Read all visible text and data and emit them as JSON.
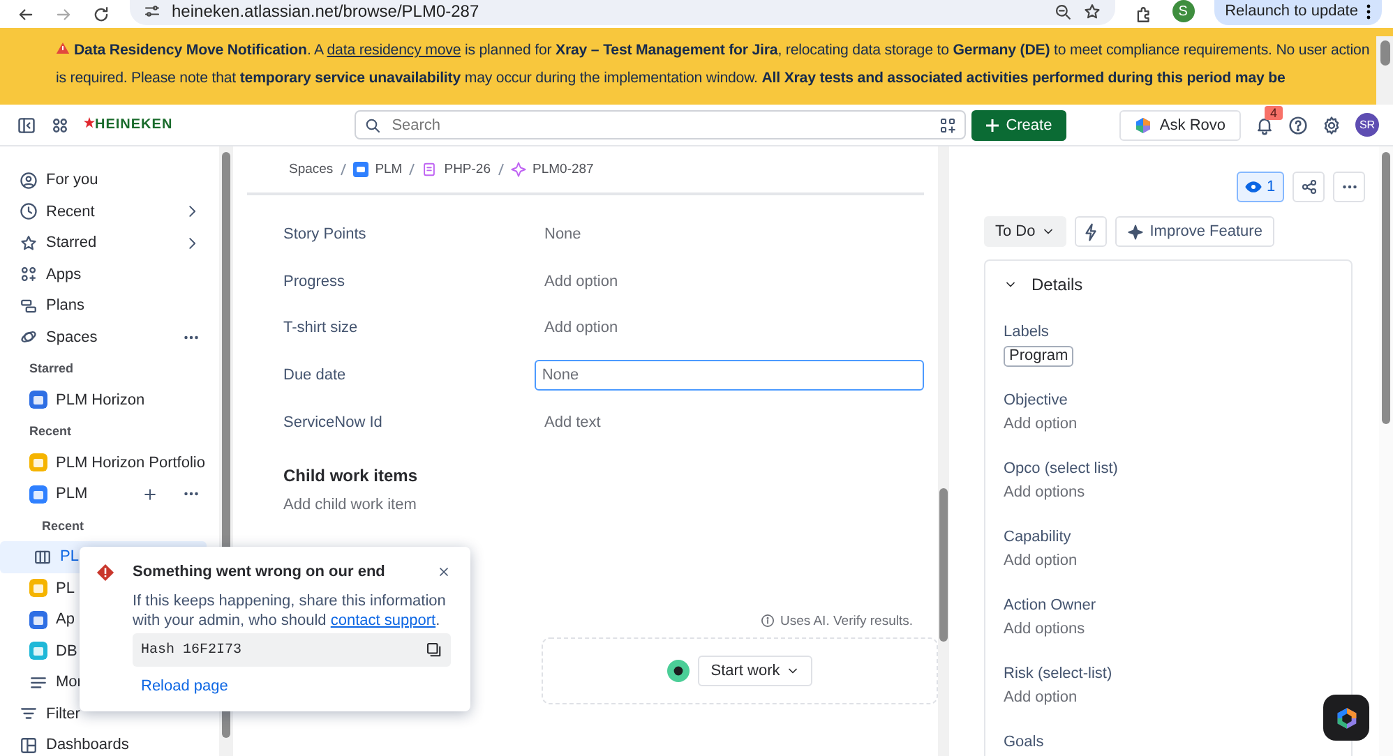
{
  "browser": {
    "url": "heineken.atlassian.net/browse/PLM0-287",
    "avatar": "S",
    "relaunch": "Relaunch to update"
  },
  "banner": {
    "title": "Data Residency Move Notification",
    "before": ". A ",
    "link": "data residency move",
    "after": " is planned for **Xray – Test Management for Jira**, relocating data storage to **Germany (DE)** to meet compliance requirements. No user action is required. Please note that **temporary service unavailability** may occur during the implementation window. **All Xray tests and associated activities performed during this period may be**"
  },
  "header": {
    "logo": "HEINEKEN",
    "search": {
      "placeholder": "Search"
    },
    "create": "Create",
    "ask": "Ask Rovo",
    "notifications": "4",
    "avatar": "SR"
  },
  "sidebar": {
    "items": [
      {
        "kind": "nav",
        "label": "For you",
        "selected": false
      },
      {
        "kind": "nav",
        "label": "Recent",
        "selected": false
      },
      {
        "kind": "nav",
        "label": "Starred",
        "selected": false
      },
      {
        "kind": "nav",
        "label": "Apps",
        "selected": false
      },
      {
        "kind": "nav",
        "label": "Plans",
        "selected": false
      },
      {
        "kind": "nav",
        "label": "Spaces",
        "selected": false
      },
      {
        "kind": "heading",
        "label": "Starred"
      },
      {
        "kind": "space",
        "label": "PLM Horizon",
        "color": "#2f6fe4",
        "selected": false
      },
      {
        "kind": "heading",
        "label": "Recent"
      },
      {
        "kind": "space",
        "label": "PLM Horizon Portfolio",
        "color": "#f5b400",
        "selected": false
      },
      {
        "kind": "space",
        "label": "PLM",
        "color": "#2f80ff",
        "selected": false
      },
      {
        "kind": "subheading",
        "label": "Recent"
      },
      {
        "kind": "board",
        "label": "PL",
        "selected": true
      },
      {
        "kind": "space",
        "label": "PL",
        "color": "#f5b400",
        "selected": false
      },
      {
        "kind": "space",
        "label": "Ap",
        "color": "#2f6fe4",
        "selected": false
      },
      {
        "kind": "space",
        "label": "DB",
        "color": "#1fb8d8",
        "selected": false
      },
      {
        "kind": "more",
        "label": "Mor",
        "selected": false
      },
      {
        "kind": "nav",
        "label": "Filter",
        "selected": false
      },
      {
        "kind": "nav",
        "label": "Dashboards",
        "selected": false
      }
    ]
  },
  "breadcrumb": [
    {
      "label": "Spaces"
    },
    {
      "label": "PLM",
      "kind": "space"
    },
    {
      "label": "PHP-26",
      "kind": "epic"
    },
    {
      "label": "PLM0-287",
      "kind": "feature"
    }
  ],
  "fields": [
    {
      "label": "Story Points",
      "value": "None",
      "kind": "text"
    },
    {
      "label": "Progress",
      "value": "Add option",
      "kind": "text"
    },
    {
      "label": "T-shirt size",
      "value": "Add option",
      "kind": "text"
    },
    {
      "label": "Due date",
      "value": "None",
      "kind": "input"
    },
    {
      "label": "ServiceNow Id",
      "value": "Add text",
      "kind": "text"
    }
  ],
  "child_items": {
    "title": "Child work items",
    "add": "Add child work item",
    "ai_note": "Uses AI. Verify results.",
    "start": "Start work"
  },
  "error_popup": {
    "title": "Something went wrong on our end",
    "before": "If this keeps happening, share this information with your admin, who should ",
    "link": "contact support",
    "after": ".",
    "hash": "Hash 16F2I73",
    "reload": "Reload page"
  },
  "right": {
    "watchers": "1",
    "status": "To Do",
    "improve": "Improve Feature",
    "details": {
      "title": "Details",
      "expanded": true,
      "fields": [
        {
          "label": "Labels",
          "value": "Program",
          "kind": "tag"
        },
        {
          "label": "Objective",
          "value": "Add option",
          "kind": "text"
        },
        {
          "label": "Opco (select list)",
          "value": "Add options",
          "kind": "text"
        },
        {
          "label": "Capability",
          "value": "Add option",
          "kind": "text"
        },
        {
          "label": "Action Owner",
          "value": "Add options",
          "kind": "text"
        },
        {
          "label": "Risk (select-list)",
          "value": "Add option",
          "kind": "text"
        },
        {
          "label": "Goals",
          "kind": "empty"
        }
      ]
    }
  }
}
